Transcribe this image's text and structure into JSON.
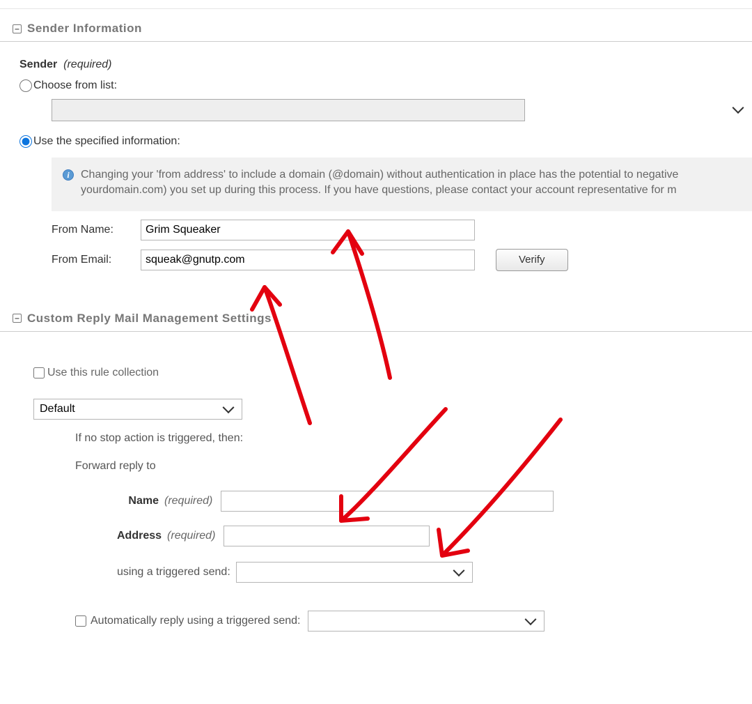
{
  "section1": {
    "title": "Sender Information",
    "sender_label": "Sender",
    "required_text": "(required)",
    "choose_from_list": "Choose from list:",
    "use_specified": "Use the specified information:",
    "info_banner": "Changing your 'from address' to include a domain (@domain) without authentication in place has the potential to negative yourdomain.com) you set up during this process. If you have questions, please contact your account representative for m",
    "from_name_label": "From Name:",
    "from_name_value": "Grim Squeaker",
    "from_email_label": "From Email:",
    "from_email_value": "squeak@gnutp.com",
    "verify_button": "Verify"
  },
  "section2": {
    "title": "Custom Reply Mail Management Settings",
    "use_rule_collection": "Use this rule collection",
    "rule_select_value": "Default",
    "stop_action_text": "If no stop action is triggered, then:",
    "forward_reply_to": "Forward reply to",
    "name_label": "Name",
    "address_label": "Address",
    "required_text": "(required)",
    "using_triggered": "using a triggered send:",
    "auto_reply": "Automatically reply using a triggered send:"
  }
}
